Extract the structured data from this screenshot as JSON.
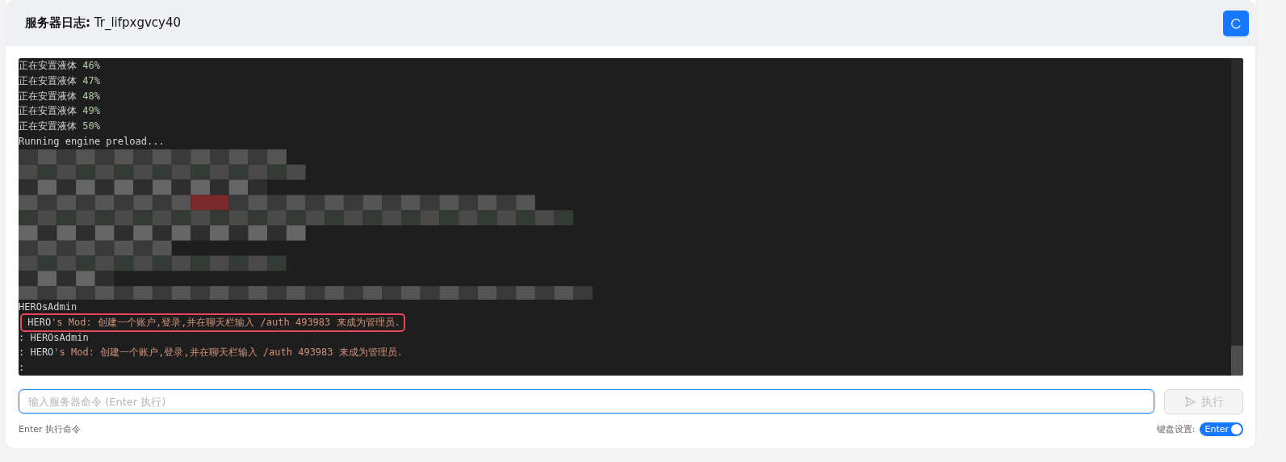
{
  "header": {
    "title_label": "服务器日志:",
    "title_value": "Tr_lifpxgvcy40"
  },
  "log": {
    "lines": [
      {
        "kind": "text",
        "highlighted": false,
        "segments": [
          {
            "kind": "plain",
            "text": "正在安置液体"
          },
          {
            "kind": "number",
            "text": "46%"
          }
        ]
      },
      {
        "kind": "text",
        "highlighted": false,
        "segments": [
          {
            "kind": "plain",
            "text": "正在安置液体"
          },
          {
            "kind": "number",
            "text": "47%"
          }
        ]
      },
      {
        "kind": "text",
        "highlighted": false,
        "segments": [
          {
            "kind": "plain",
            "text": "正在安置液体"
          },
          {
            "kind": "number",
            "text": "48%"
          }
        ]
      },
      {
        "kind": "text",
        "highlighted": false,
        "segments": [
          {
            "kind": "plain",
            "text": "正在安置液体"
          },
          {
            "kind": "number",
            "text": "49%"
          }
        ]
      },
      {
        "kind": "text",
        "highlighted": false,
        "segments": [
          {
            "kind": "plain",
            "text": "正在安置液体"
          },
          {
            "kind": "number",
            "text": "50%"
          }
        ]
      },
      {
        "kind": "text",
        "highlighted": false,
        "segments": [
          {
            "kind": "plain",
            "text": "Running engine preload..."
          }
        ]
      },
      {
        "kind": "redacted"
      },
      {
        "kind": "text",
        "highlighted": false,
        "segments": [
          {
            "kind": "plain",
            "text": "HEROsAdmin"
          }
        ]
      },
      {
        "kind": "text",
        "highlighted": true,
        "segments": [
          {
            "kind": "plain",
            "text": " HERO"
          },
          {
            "kind": "mod",
            "text": "'s Mod: 创建一个账户,登录,并在聊天栏输入 /auth 493983 来成为管理员."
          }
        ]
      },
      {
        "kind": "text",
        "highlighted": false,
        "segments": [
          {
            "kind": "plain",
            "text": ": HEROsAdmin"
          }
        ]
      },
      {
        "kind": "text",
        "highlighted": false,
        "segments": [
          {
            "kind": "plain",
            "text": ": HERO"
          },
          {
            "kind": "mod",
            "text": "'s Mod: 创建一个账户,登录,并在聊天栏输入 /auth 493983 来成为管理员."
          }
        ]
      },
      {
        "kind": "text",
        "highlighted": false,
        "segments": [
          {
            "kind": "plain",
            "text": ":"
          }
        ]
      }
    ]
  },
  "command": {
    "placeholder": "输入服务器命令 (Enter 执行)",
    "button": "执行",
    "button_disabled": true,
    "hint": "Enter 执行命令"
  },
  "keyboard": {
    "label": "键盘设置:",
    "toggle_label": "Enter",
    "on": true
  }
}
